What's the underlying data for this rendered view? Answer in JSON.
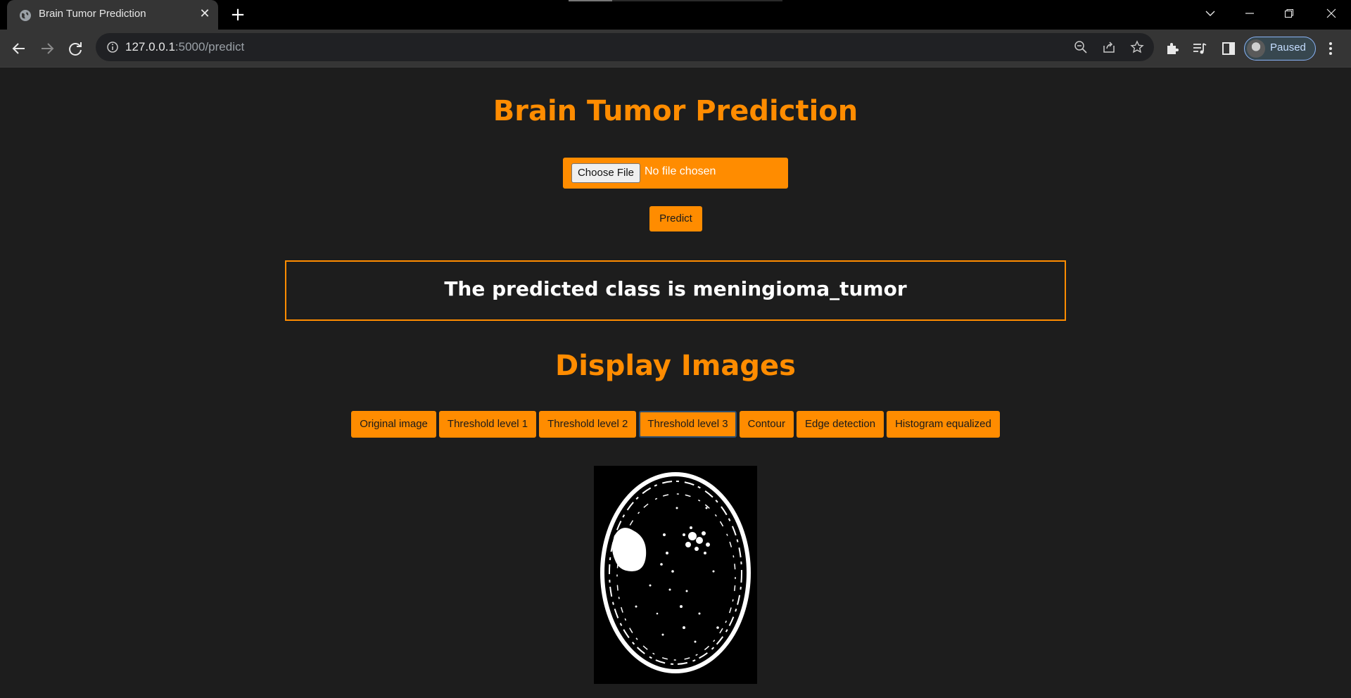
{
  "browser": {
    "tab_title": "Brain Tumor Prediction",
    "tab_close": "✕",
    "new_tab": "+",
    "url_host": "127.0.0.1",
    "url_rest": ":5000/predict",
    "profile_label": "Paused",
    "window_controls": {
      "dropdown": "⌄",
      "minimize": "—",
      "restore": "❐",
      "close": "✕"
    }
  },
  "page": {
    "title": "Brain Tumor Prediction",
    "choose_file_label": "Choose File",
    "file_status": "No file chosen",
    "predict_label": "Predict",
    "result_text": "The predicted class is meningioma_tumor",
    "display_heading": "Display Images",
    "image_buttons": [
      "Original image",
      "Threshold level 1",
      "Threshold level 2",
      "Threshold level 3",
      "Contour",
      "Edge detection",
      "Histogram equalized"
    ],
    "active_button": "Threshold level 3"
  },
  "colors": {
    "accent": "#ff8c00",
    "page_bg": "#1d1d1d",
    "chrome_bg": "#353535",
    "tabbar_bg": "#000000"
  }
}
